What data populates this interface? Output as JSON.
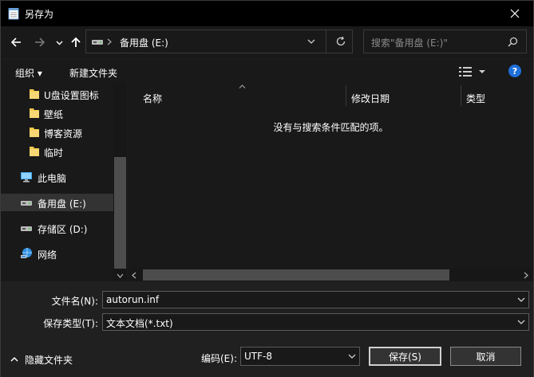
{
  "window": {
    "title": "另存为"
  },
  "address": {
    "path": "备用盘 (E:)"
  },
  "search": {
    "placeholder": "搜索\"备用盘 (E:)\""
  },
  "toolbar": {
    "organize_label": "组织 ▾",
    "new_folder_label": "新建文件夹"
  },
  "sidebar": {
    "items": [
      {
        "label": "U盘设置图标",
        "icon": "folder-icon"
      },
      {
        "label": "壁纸",
        "icon": "folder-icon"
      },
      {
        "label": "博客资源",
        "icon": "folder-icon"
      },
      {
        "label": "临时",
        "icon": "folder-icon"
      },
      {
        "label": "此电脑",
        "icon": "computer-icon"
      },
      {
        "label": "备用盘 (E:)",
        "icon": "drive-icon",
        "selected": true
      },
      {
        "label": "存储区 (D:)",
        "icon": "drive-icon"
      },
      {
        "label": "网络",
        "icon": "network-icon"
      }
    ]
  },
  "file_list": {
    "columns": [
      "名称",
      "修改日期",
      "类型"
    ],
    "empty_message": "没有与搜索条件匹配的项。"
  },
  "form": {
    "filename_label": "文件名(N):",
    "filename_value": "autorun.inf",
    "filetype_label": "保存类型(T):",
    "filetype_value": "文本文档(*.txt)",
    "encoding_label": "编码(E):",
    "encoding_value": "UTF-8",
    "hide_folders_label": "隐藏文件夹",
    "save_label": "保存(S)",
    "cancel_label": "取消"
  },
  "colors": {
    "background": "#191919",
    "folder": "#f2c94c",
    "help": "#1e6fd9"
  }
}
